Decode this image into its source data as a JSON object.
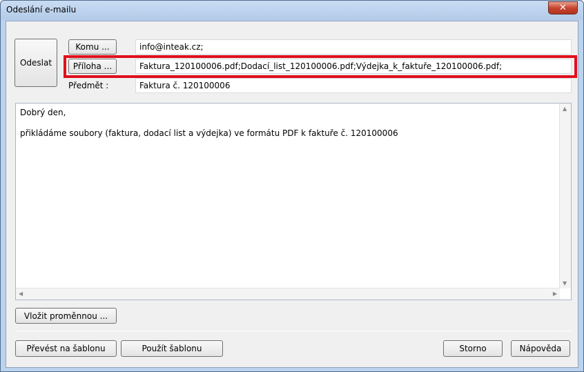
{
  "window": {
    "title": "Odeslání e-mailu",
    "close_label": "✕"
  },
  "buttons": {
    "send": "Odeslat",
    "to": "Komu ...",
    "attachment": "Příloha ...",
    "insert_variable": "Vložit proměnnou ...",
    "convert_template": "Převést na šablonu",
    "use_template": "Použít šablonu",
    "cancel": "Storno",
    "help": "Nápověda"
  },
  "fields": {
    "to_value": "info@inteak.cz;",
    "attachment_value": "Faktura_120100006.pdf;Dodací_list_120100006.pdf;Výdejka_k_faktuře_120100006.pdf;",
    "subject_label": "Předmět :",
    "subject_value": "Faktura č. 120100006"
  },
  "message": {
    "line1": "Dobrý den,",
    "line2": "přikládáme soubory (faktura, dodací list a výdejka) ve formátu PDF k faktuře č. 120100006"
  },
  "colors": {
    "highlight": "#e0101c",
    "close_button": "#c7452f"
  }
}
